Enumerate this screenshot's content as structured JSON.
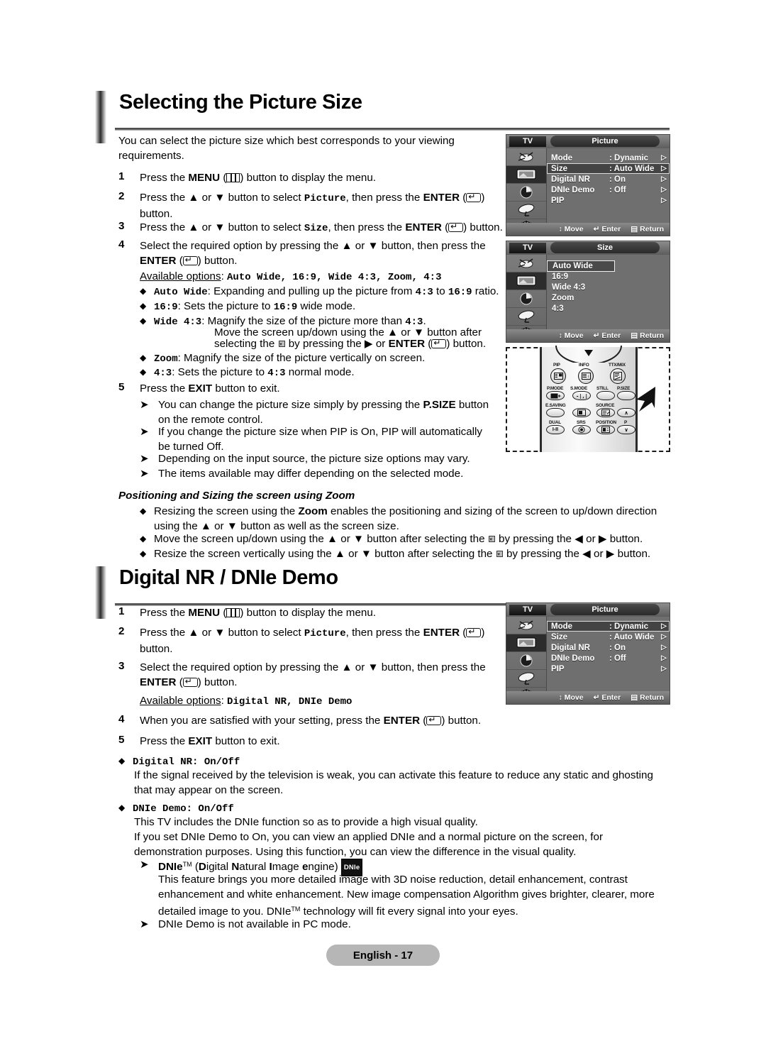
{
  "page": {
    "footer_label": "English - 17"
  },
  "section1": {
    "title": "Selecting the Picture Size",
    "intro": "You can select the picture size which best corresponds to your viewing requirements.",
    "steps": [
      {
        "num": "1",
        "text_a": "Press the ",
        "bold_a": "MENU",
        "text_b": " (",
        "glyph": "menu-icon",
        "text_c": ") button to display the menu."
      },
      {
        "num": "2",
        "text_a": "Press the ▲ or ▼ button to select ",
        "mono_a": "Picture",
        "text_b": ", then press the ",
        "bold_a": "ENTER",
        "text_c": " (",
        "glyph": "enter-icon",
        "text_d": ") button."
      },
      {
        "num": "3",
        "text_a": "Press the ▲ or ▼ button to select ",
        "mono_a": "Size",
        "text_b": ", then press the ",
        "bold_a": "ENTER",
        "text_c": " (",
        "glyph": "enter-icon",
        "text_d": ") button."
      },
      {
        "num": "4",
        "text_a": "Select the required option by pressing the ▲ or ▼ button, then press the ",
        "bold_a": "ENTER",
        "text_b": " (",
        "glyph": "enter-icon",
        "text_c": ") button."
      },
      {
        "num": "5",
        "text_a": "Press the ",
        "bold_a": "EXIT",
        "text_b": " button to exit."
      }
    ],
    "available_label": "Available options",
    "available_options": "Auto Wide, 16:9, Wide 4:3, Zoom, 4:3",
    "option_bullets": [
      {
        "name": "Auto Wide",
        "desc_a": ": Expanding and pulling up the picture from ",
        "mono_b": "4:3",
        "desc_b": " to ",
        "mono_c": "16:9",
        "desc_c": " ratio."
      },
      {
        "name": "16:9",
        "desc_a": ": Sets the picture to ",
        "mono_b": "16:9",
        "desc_b": " wide mode."
      },
      {
        "name": "Wide 4:3",
        "desc_a": ": Magnify the size of the picture more than ",
        "mono_b": "4:3",
        "desc_b": "."
      },
      {
        "name": "Zoom",
        "desc_a": ": Magnify the size of the picture vertically on screen."
      },
      {
        "name": "4:3",
        "desc_a": ": Sets the picture to ",
        "mono_b": "4:3",
        "desc_b": " normal mode."
      }
    ],
    "wide43_extra_line1": "Move the screen up/down using the ▲ or ▼ button after",
    "wide43_extra_line2_a": "selecting the ",
    "wide43_extra_line2_b": " by pressing the ▶ or ",
    "wide43_extra_line2_bold": "ENTER",
    "wide43_extra_line2_c": " (",
    "wide43_extra_line2_d": ") button.",
    "notes": [
      {
        "text_a": "You can change the picture size simply by pressing the ",
        "bold_a": "P.SIZE",
        "text_b": " button on the remote control."
      },
      {
        "text_a": "If you change the picture size when PIP is On, PIP will automatically be turned Off."
      },
      {
        "text_a": "Depending on the input source, the picture size options may vary."
      },
      {
        "text_a": "The items available may differ depending on the selected mode."
      }
    ],
    "zoom_heading": "Positioning and Sizing the screen using Zoom",
    "zoom_bullets": [
      {
        "text_a": "Resizing the screen using the ",
        "bold_a": "Zoom",
        "text_b": " enables the positioning and sizing of the screen to up/down direction using the ▲ or ▼ button as well as the screen size."
      },
      {
        "text_a": "Move the screen up/down using the ▲ or ▼ button after selecting the ",
        "glyph": "position-icon",
        "text_b": " by pressing the ◀ or ▶ button."
      },
      {
        "text_a": "Resize the screen vertically using the ▲ or ▼ button after selecting the ",
        "glyph": "size-icon",
        "text_b": " by pressing the ◀ or ▶ button."
      }
    ]
  },
  "section2": {
    "title": "Digital NR / DNIe Demo",
    "steps": [
      {
        "num": "1",
        "text_a": "Press the ",
        "bold_a": "MENU",
        "text_b": " (",
        "glyph": "menu-icon",
        "text_c": ") button to display the menu."
      },
      {
        "num": "2",
        "text_a": "Press the ▲ or ▼ button to select ",
        "mono_a": "Picture",
        "text_b": ", then press the ",
        "bold_a": "ENTER",
        "text_c": " (",
        "glyph": "enter-icon",
        "text_d": ") button."
      },
      {
        "num": "3",
        "text_a": "Select the required option by pressing the ▲ or ▼ button, then press the ",
        "bold_a": "ENTER",
        "text_b": " (",
        "glyph": "enter-icon",
        "text_c": ") button."
      },
      {
        "num": "4",
        "text_a": "When you are satisfied with your setting, press the ",
        "bold_a": "ENTER",
        "text_b": " (",
        "glyph": "enter-icon",
        "text_c": ") button."
      },
      {
        "num": "5",
        "text_a": "Press the ",
        "bold_a": "EXIT",
        "text_b": " button to exit."
      }
    ],
    "available_label": "Available options",
    "available_options": "Digital NR, DNIe Demo",
    "topics": [
      {
        "title_mono": "Digital NR",
        "title_rest": ": On/Off",
        "body": "If the signal received by the television is weak, you can activate this feature to reduce any static and ghosting that may appear on the screen."
      },
      {
        "title_mono": "DNIe Demo",
        "title_rest": ": On/Off",
        "body_line1": "This TV includes the DNIe function so as to provide a high visual quality.",
        "body_line2": "If you set DNIe Demo to On, you can view an applied DNIe and a normal picture on the screen, for demonstration purposes. Using this function, you can view the difference in the visual quality."
      }
    ],
    "dnie_note": {
      "title_bold": "DNIe",
      "title_tm": "TM",
      "title_rest_a": " (",
      "title_rest_b": "D",
      "title_rest_c": "igital ",
      "title_rest_d": "N",
      "title_rest_e": "atural ",
      "title_rest_f": "I",
      "title_rest_g": "mage ",
      "title_rest_h": "e",
      "title_rest_i": "ngine) ",
      "badge": "DNIe",
      "body_line1": "This feature brings you more detailed image with 3D noise reduction, detail enhancement, contrast",
      "body_line2": "enhancement and white enhancement. New image compensation Algorithm gives brighter, clearer, more",
      "body_line3_a": "detailed image to you. DNIe",
      "body_line3_tm": "TM",
      "body_line3_b": " technology will fit every signal into your eyes."
    },
    "pc_note": "DNIe Demo is not available in PC mode."
  },
  "osd_picture_top": {
    "tv_label": "TV",
    "title": "Picture",
    "rows": [
      {
        "label": "Mode",
        "value": ": Dynamic",
        "selected": false
      },
      {
        "label": "Size",
        "value": ": Auto Wide",
        "selected": true
      },
      {
        "label": "Digital NR",
        "value": ": On",
        "selected": false
      },
      {
        "label": "DNIe Demo",
        "value": ": Off",
        "selected": false
      },
      {
        "label": "PIP",
        "value": "",
        "selected": false
      }
    ],
    "footer": {
      "move": "Move",
      "enter": "Enter",
      "return": "Return"
    }
  },
  "osd_size": {
    "tv_label": "TV",
    "title": "Size",
    "options": [
      {
        "label": "Auto Wide",
        "selected": true
      },
      {
        "label": "16:9",
        "selected": false
      },
      {
        "label": "Wide 4:3",
        "selected": false
      },
      {
        "label": "Zoom",
        "selected": false
      },
      {
        "label": "4:3",
        "selected": false
      }
    ],
    "footer": {
      "move": "Move",
      "enter": "Enter",
      "return": "Return"
    }
  },
  "osd_picture_bottom": {
    "tv_label": "TV",
    "title": "Picture",
    "rows": [
      {
        "label": "Mode",
        "value": ": Dynamic",
        "selected": true
      },
      {
        "label": "Size",
        "value": ": Auto Wide",
        "selected": false
      },
      {
        "label": "Digital NR",
        "value": ": On",
        "selected": false
      },
      {
        "label": "DNIe Demo",
        "value": ": Off",
        "selected": false
      },
      {
        "label": "PIP",
        "value": "",
        "selected": false
      }
    ],
    "footer": {
      "move": "Move",
      "enter": "Enter",
      "return": "Return"
    }
  },
  "remote": {
    "rows": [
      {
        "labels": [
          "PIP",
          "INFO",
          "TTX/MIX"
        ]
      },
      {
        "labels": [
          "P.MODE",
          "S.MODE",
          "STILL",
          "P.SIZE"
        ]
      },
      {
        "labels": [
          "E.SAVING",
          "",
          "SOURCE",
          ""
        ]
      },
      {
        "labels": [
          "DUAL",
          "SRS",
          "POSITION",
          "P"
        ]
      }
    ],
    "button_texts": {
      "dual": "I-II",
      "p_up": "∧",
      "p_down": "∨"
    }
  }
}
